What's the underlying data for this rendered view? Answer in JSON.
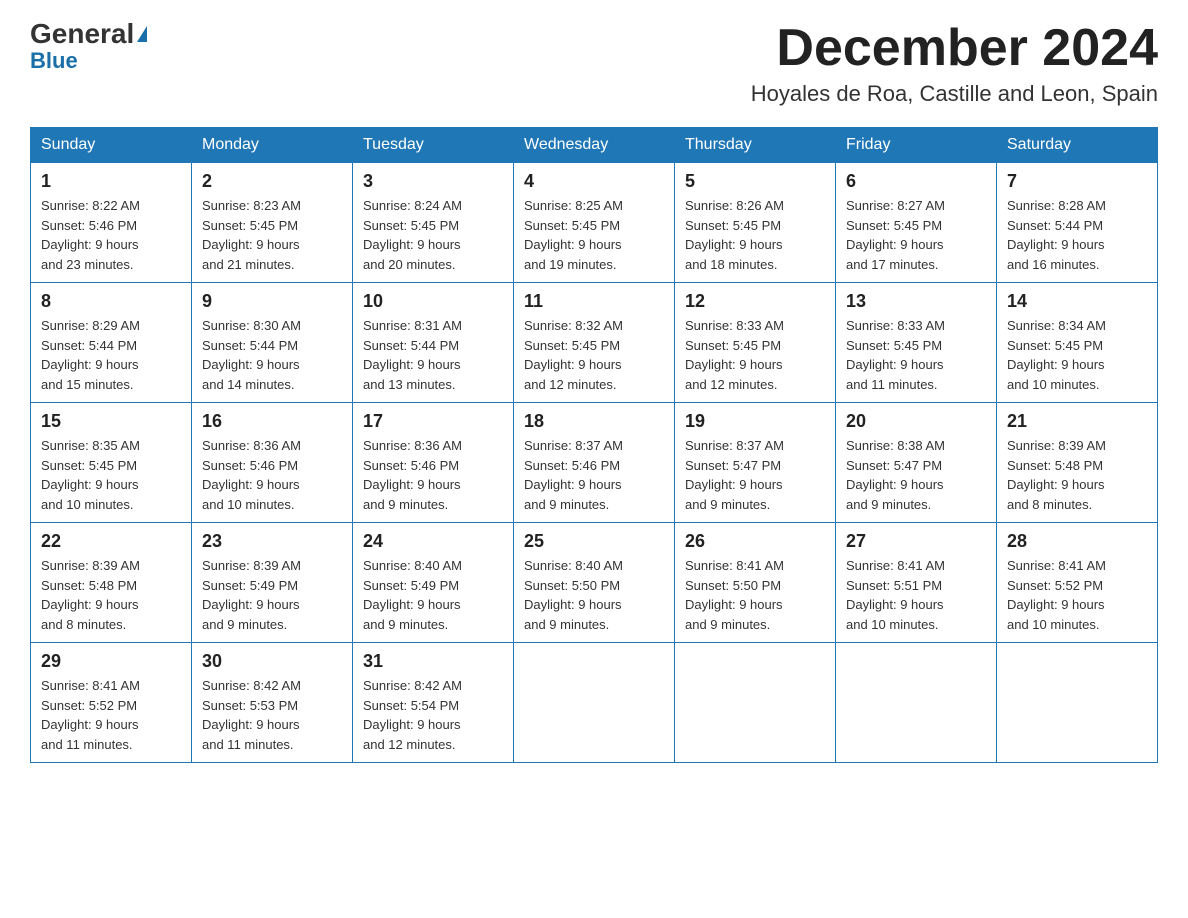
{
  "logo": {
    "top": "General",
    "bottom": "Blue"
  },
  "title": "December 2024",
  "location": "Hoyales de Roa, Castille and Leon, Spain",
  "days_of_week": [
    "Sunday",
    "Monday",
    "Tuesday",
    "Wednesday",
    "Thursday",
    "Friday",
    "Saturday"
  ],
  "weeks": [
    [
      {
        "date": "1",
        "info": "Sunrise: 8:22 AM\nSunset: 5:46 PM\nDaylight: 9 hours\nand 23 minutes."
      },
      {
        "date": "2",
        "info": "Sunrise: 8:23 AM\nSunset: 5:45 PM\nDaylight: 9 hours\nand 21 minutes."
      },
      {
        "date": "3",
        "info": "Sunrise: 8:24 AM\nSunset: 5:45 PM\nDaylight: 9 hours\nand 20 minutes."
      },
      {
        "date": "4",
        "info": "Sunrise: 8:25 AM\nSunset: 5:45 PM\nDaylight: 9 hours\nand 19 minutes."
      },
      {
        "date": "5",
        "info": "Sunrise: 8:26 AM\nSunset: 5:45 PM\nDaylight: 9 hours\nand 18 minutes."
      },
      {
        "date": "6",
        "info": "Sunrise: 8:27 AM\nSunset: 5:45 PM\nDaylight: 9 hours\nand 17 minutes."
      },
      {
        "date": "7",
        "info": "Sunrise: 8:28 AM\nSunset: 5:44 PM\nDaylight: 9 hours\nand 16 minutes."
      }
    ],
    [
      {
        "date": "8",
        "info": "Sunrise: 8:29 AM\nSunset: 5:44 PM\nDaylight: 9 hours\nand 15 minutes."
      },
      {
        "date": "9",
        "info": "Sunrise: 8:30 AM\nSunset: 5:44 PM\nDaylight: 9 hours\nand 14 minutes."
      },
      {
        "date": "10",
        "info": "Sunrise: 8:31 AM\nSunset: 5:44 PM\nDaylight: 9 hours\nand 13 minutes."
      },
      {
        "date": "11",
        "info": "Sunrise: 8:32 AM\nSunset: 5:45 PM\nDaylight: 9 hours\nand 12 minutes."
      },
      {
        "date": "12",
        "info": "Sunrise: 8:33 AM\nSunset: 5:45 PM\nDaylight: 9 hours\nand 12 minutes."
      },
      {
        "date": "13",
        "info": "Sunrise: 8:33 AM\nSunset: 5:45 PM\nDaylight: 9 hours\nand 11 minutes."
      },
      {
        "date": "14",
        "info": "Sunrise: 8:34 AM\nSunset: 5:45 PM\nDaylight: 9 hours\nand 10 minutes."
      }
    ],
    [
      {
        "date": "15",
        "info": "Sunrise: 8:35 AM\nSunset: 5:45 PM\nDaylight: 9 hours\nand 10 minutes."
      },
      {
        "date": "16",
        "info": "Sunrise: 8:36 AM\nSunset: 5:46 PM\nDaylight: 9 hours\nand 10 minutes."
      },
      {
        "date": "17",
        "info": "Sunrise: 8:36 AM\nSunset: 5:46 PM\nDaylight: 9 hours\nand 9 minutes."
      },
      {
        "date": "18",
        "info": "Sunrise: 8:37 AM\nSunset: 5:46 PM\nDaylight: 9 hours\nand 9 minutes."
      },
      {
        "date": "19",
        "info": "Sunrise: 8:37 AM\nSunset: 5:47 PM\nDaylight: 9 hours\nand 9 minutes."
      },
      {
        "date": "20",
        "info": "Sunrise: 8:38 AM\nSunset: 5:47 PM\nDaylight: 9 hours\nand 9 minutes."
      },
      {
        "date": "21",
        "info": "Sunrise: 8:39 AM\nSunset: 5:48 PM\nDaylight: 9 hours\nand 8 minutes."
      }
    ],
    [
      {
        "date": "22",
        "info": "Sunrise: 8:39 AM\nSunset: 5:48 PM\nDaylight: 9 hours\nand 8 minutes."
      },
      {
        "date": "23",
        "info": "Sunrise: 8:39 AM\nSunset: 5:49 PM\nDaylight: 9 hours\nand 9 minutes."
      },
      {
        "date": "24",
        "info": "Sunrise: 8:40 AM\nSunset: 5:49 PM\nDaylight: 9 hours\nand 9 minutes."
      },
      {
        "date": "25",
        "info": "Sunrise: 8:40 AM\nSunset: 5:50 PM\nDaylight: 9 hours\nand 9 minutes."
      },
      {
        "date": "26",
        "info": "Sunrise: 8:41 AM\nSunset: 5:50 PM\nDaylight: 9 hours\nand 9 minutes."
      },
      {
        "date": "27",
        "info": "Sunrise: 8:41 AM\nSunset: 5:51 PM\nDaylight: 9 hours\nand 10 minutes."
      },
      {
        "date": "28",
        "info": "Sunrise: 8:41 AM\nSunset: 5:52 PM\nDaylight: 9 hours\nand 10 minutes."
      }
    ],
    [
      {
        "date": "29",
        "info": "Sunrise: 8:41 AM\nSunset: 5:52 PM\nDaylight: 9 hours\nand 11 minutes."
      },
      {
        "date": "30",
        "info": "Sunrise: 8:42 AM\nSunset: 5:53 PM\nDaylight: 9 hours\nand 11 minutes."
      },
      {
        "date": "31",
        "info": "Sunrise: 8:42 AM\nSunset: 5:54 PM\nDaylight: 9 hours\nand 12 minutes."
      },
      null,
      null,
      null,
      null
    ]
  ]
}
